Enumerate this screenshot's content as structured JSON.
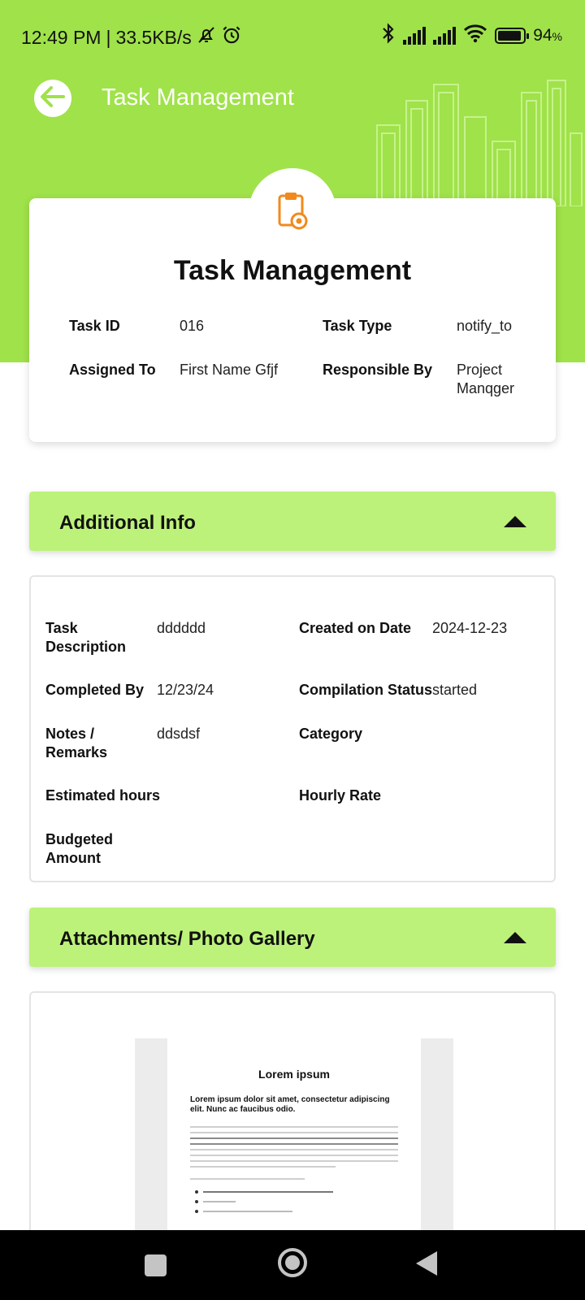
{
  "status_bar": {
    "time": "12:49 PM",
    "separator": "|",
    "speed": "33.5KB/s",
    "battery": "94",
    "battery_unit": "%",
    "battery_level": 0.94,
    "icons": [
      "bell-off-icon",
      "alarm-icon",
      "bluetooth-icon",
      "signal-icon",
      "signal-icon",
      "wifi-icon",
      "battery-icon"
    ]
  },
  "header": {
    "title": "Task Management",
    "back_icon": "arrow-left-icon",
    "color": "#a0e24a"
  },
  "task_card": {
    "icon": "clipboard-eye-icon",
    "icon_color": "#f08a1c",
    "title": "Task Management",
    "fields": [
      {
        "label": "Task ID",
        "value": "016"
      },
      {
        "label": "Task Type",
        "value": "notify_to"
      },
      {
        "label": "Assigned To",
        "value": "First Name Gfjf"
      },
      {
        "label": "Responsible By",
        "value": "Project Manqger"
      }
    ]
  },
  "additional_info": {
    "title": "Additional Info",
    "toggle_icon": "caret-up-icon",
    "header_color": "#bdf27a",
    "fields": [
      {
        "label": "Task Description",
        "value": "dddddd"
      },
      {
        "label": "Created on Date",
        "value": "2024-12-23"
      },
      {
        "label": "Completed By",
        "value": "12/23/24"
      },
      {
        "label": "Compilation Status",
        "value": "started"
      },
      {
        "label": "Notes / Remarks",
        "value": "ddsdsf"
      },
      {
        "label": "Category",
        "value": ""
      },
      {
        "label": "Estimated hours",
        "value": ""
      },
      {
        "label": "Hourly Rate",
        "value": ""
      },
      {
        "label": "Budgeted Amount",
        "value": ""
      }
    ]
  },
  "attachments": {
    "title": "Attachments/ Photo Gallery",
    "toggle_icon": "caret-up-icon",
    "document": {
      "title": "Lorem ipsum",
      "lead": "Lorem ipsum dolor sit amet, consectetur adipiscing elit. Nunc ac faucibus odio."
    }
  },
  "nav_bar": {
    "icons": [
      "recents-square-icon",
      "home-circle-icon",
      "back-triangle-icon"
    ]
  }
}
